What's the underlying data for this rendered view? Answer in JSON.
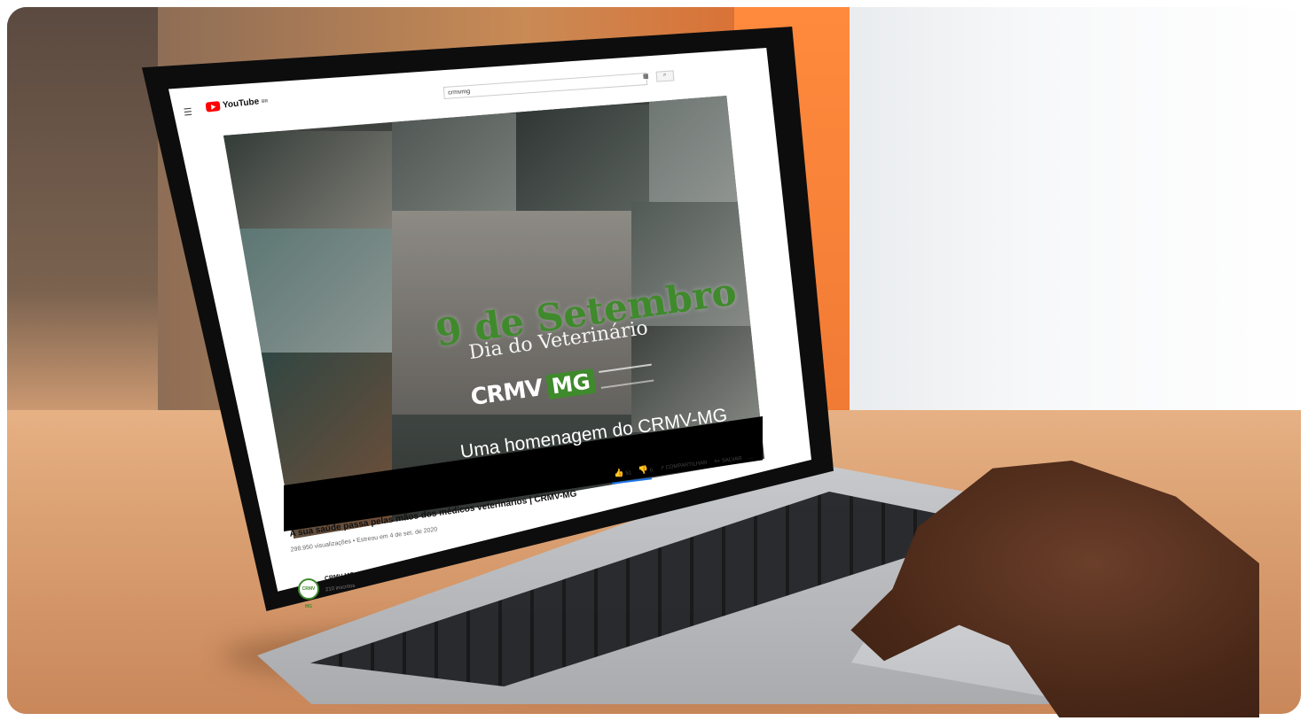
{
  "youtube": {
    "logo_text": "YouTube",
    "logo_region": "BR",
    "menu_icon": "hamburger-icon",
    "search_value": "crmvmg",
    "keyboard_icon": "keyboard-icon",
    "search_icon": "search-icon"
  },
  "video": {
    "title_overlay": "9 de Setembro",
    "subtitle_overlay": "Dia do Veterinário",
    "brand_left": "CRMV",
    "brand_right": "MG",
    "caption": "Uma homenagem do CRMV-MG",
    "accent_color": "#3f8a2c"
  },
  "details": {
    "heading": "A sua saúde passa pelas mãos dos médicos veterinários | CRMV-MG",
    "stats": "298.950 visualizações • Estreou em 4 de set. de 2020",
    "likes": "51",
    "dislikes": "6",
    "share_label": "COMPARTILHAR",
    "save_label": "SALVAR",
    "more_label": "..."
  },
  "channel": {
    "name": "CRMV MG",
    "subscribers": "210 inscritos",
    "avatar_text": "CRMV MG"
  }
}
